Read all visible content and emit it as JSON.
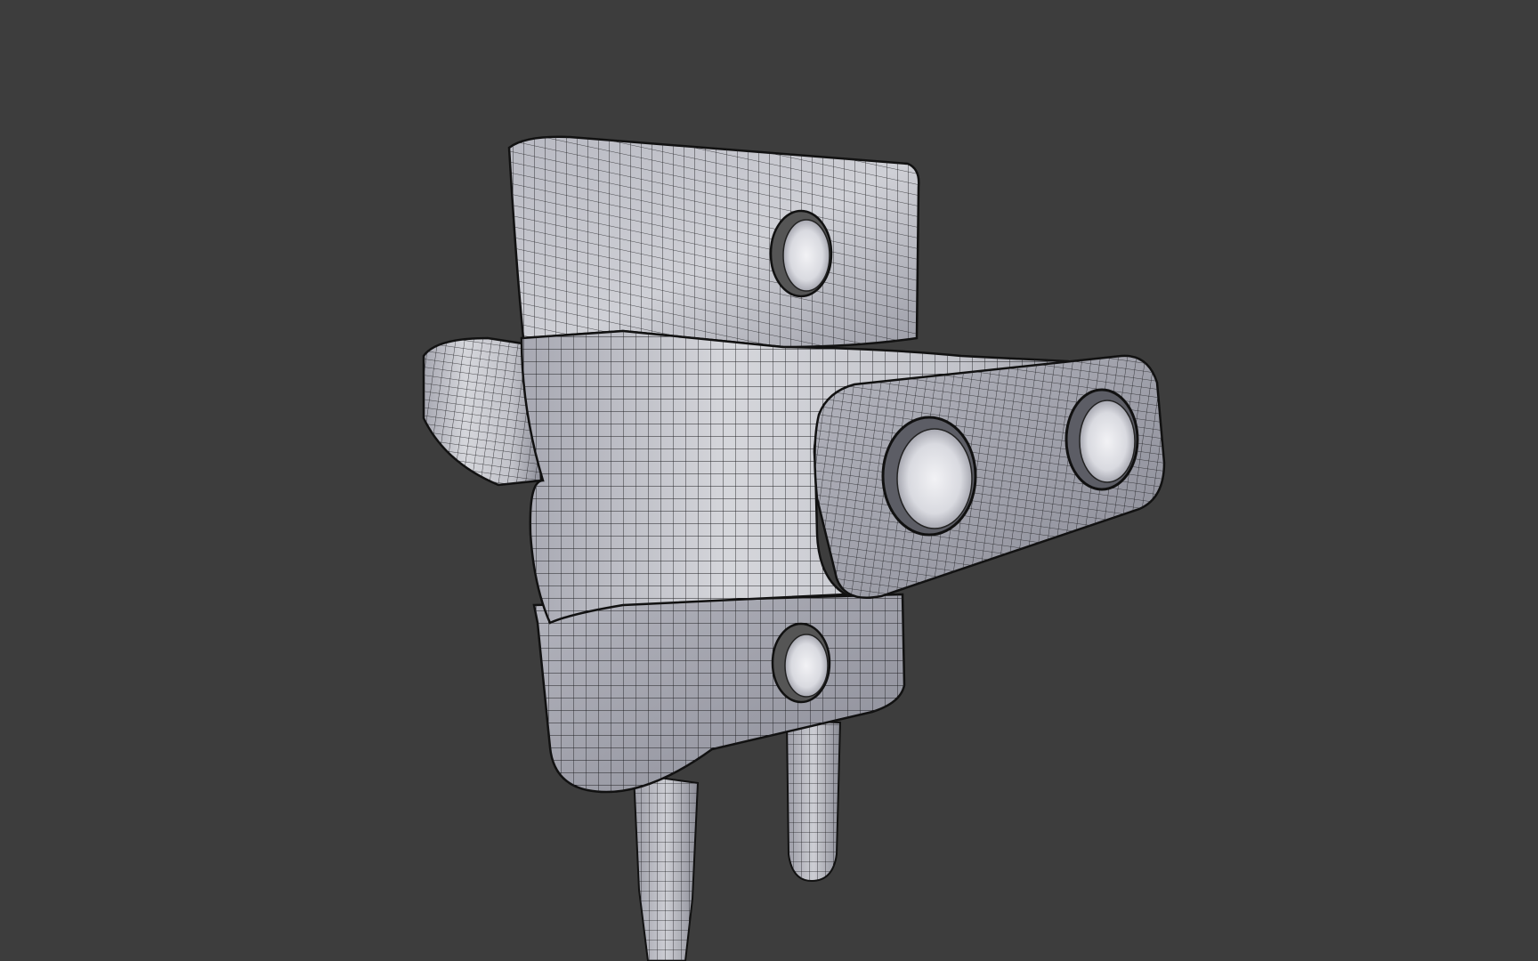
{
  "viewport": {
    "background_color": "#3d3d3d",
    "mesh_fill_light": "#c9cad0",
    "mesh_fill_shadow": "#8f909a",
    "mesh_wire_color": "#1a1a1a",
    "hole_inner_color": "#e9e9ee"
  },
  "object": {
    "semantic": "plug-adapter-wireframe-mesh"
  }
}
